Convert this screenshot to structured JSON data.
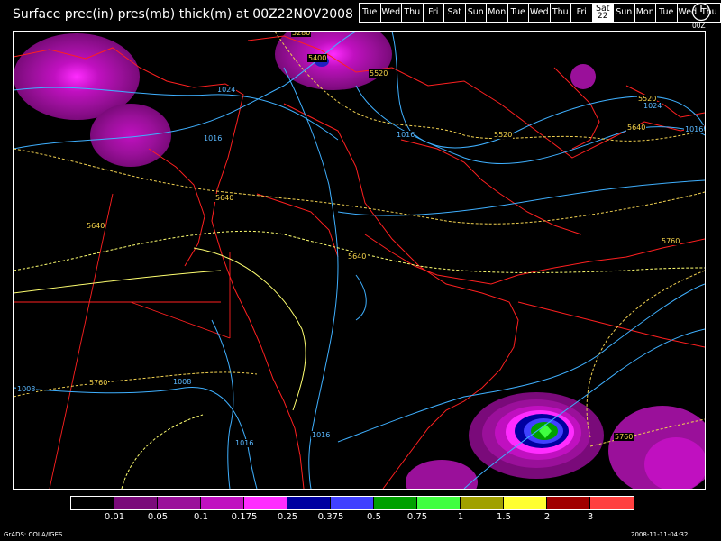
{
  "header": {
    "title": "Surface prec(in) pres(mb) thick(m) at 00Z22NOV2008"
  },
  "day_strip": {
    "days": [
      "Tue",
      "Wed",
      "Thu",
      "Fri",
      "Sat",
      "Sun",
      "Mon",
      "Tue",
      "Wed",
      "Thu",
      "Fri",
      "Sat",
      "Sun",
      "Mon",
      "Tue",
      "Wed",
      "Thu"
    ],
    "active_index": 11,
    "active_date": "22"
  },
  "clock": {
    "label": "00Z"
  },
  "map": {
    "background": "#000000",
    "thickness_labels": [
      "5280",
      "5400",
      "5520",
      "5520",
      "5520",
      "5640",
      "5640",
      "5640",
      "5640",
      "5760",
      "5760",
      "5760"
    ],
    "pressure_labels": [
      "1024",
      "1016",
      "1016",
      "1024",
      "1016",
      "1008",
      "1008",
      "1016",
      "1016"
    ],
    "colors": {
      "coast": "#ff2020",
      "pressure": "#3fb0ff",
      "thickness_a": "#f0d050",
      "thickness_b": "#ffff70"
    }
  },
  "colorbar": {
    "colors": [
      "#000000",
      "#7a0a7a",
      "#9a109a",
      "#c010c0",
      "#ff2cff",
      "#0000a0",
      "#4040ff",
      "#00a000",
      "#40ff40",
      "#a0a000",
      "#ffff30",
      "#a00000",
      "#ff4040"
    ],
    "labels": [
      "0.01",
      "0.05",
      "0.1",
      "0.175",
      "0.25",
      "0.375",
      "0.5",
      "0.75",
      "1",
      "1.5",
      "2",
      "3"
    ]
  },
  "footer": {
    "credit": "GrADS: COLA/IGES",
    "timestamp": "2008-11-11-04:32"
  }
}
